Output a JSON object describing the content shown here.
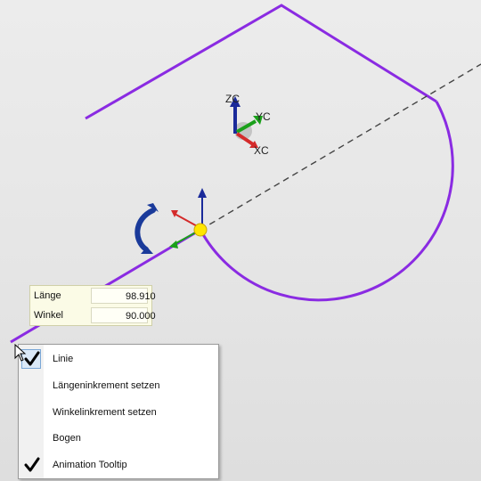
{
  "viewport": {
    "axes_triad": {
      "z_label": "ZC",
      "y_label": "YC",
      "x_label": "XC"
    },
    "colors": {
      "curve": "#8a2be2",
      "z_axis": "#1a2a9a",
      "y_axis": "#1aa01a",
      "x_axis": "#d42a2a",
      "handle": "#ffe600",
      "rotation_arrow": "#1a3a9a"
    }
  },
  "input_panel": {
    "rows": [
      {
        "label": "Länge",
        "value": "98.910"
      },
      {
        "label": "Winkel",
        "value": "90.000"
      }
    ]
  },
  "context_menu": {
    "items": [
      {
        "label": "Linie",
        "checked": true,
        "icon": "checkmark-icon"
      },
      {
        "label": "Längeninkrement setzen",
        "checked": false
      },
      {
        "label": "Winkelinkrement setzen",
        "checked": false
      },
      {
        "label": "Bogen",
        "checked": false
      },
      {
        "label": "Animation Tooltip",
        "checked": true,
        "icon": "checkmark-icon"
      }
    ]
  }
}
